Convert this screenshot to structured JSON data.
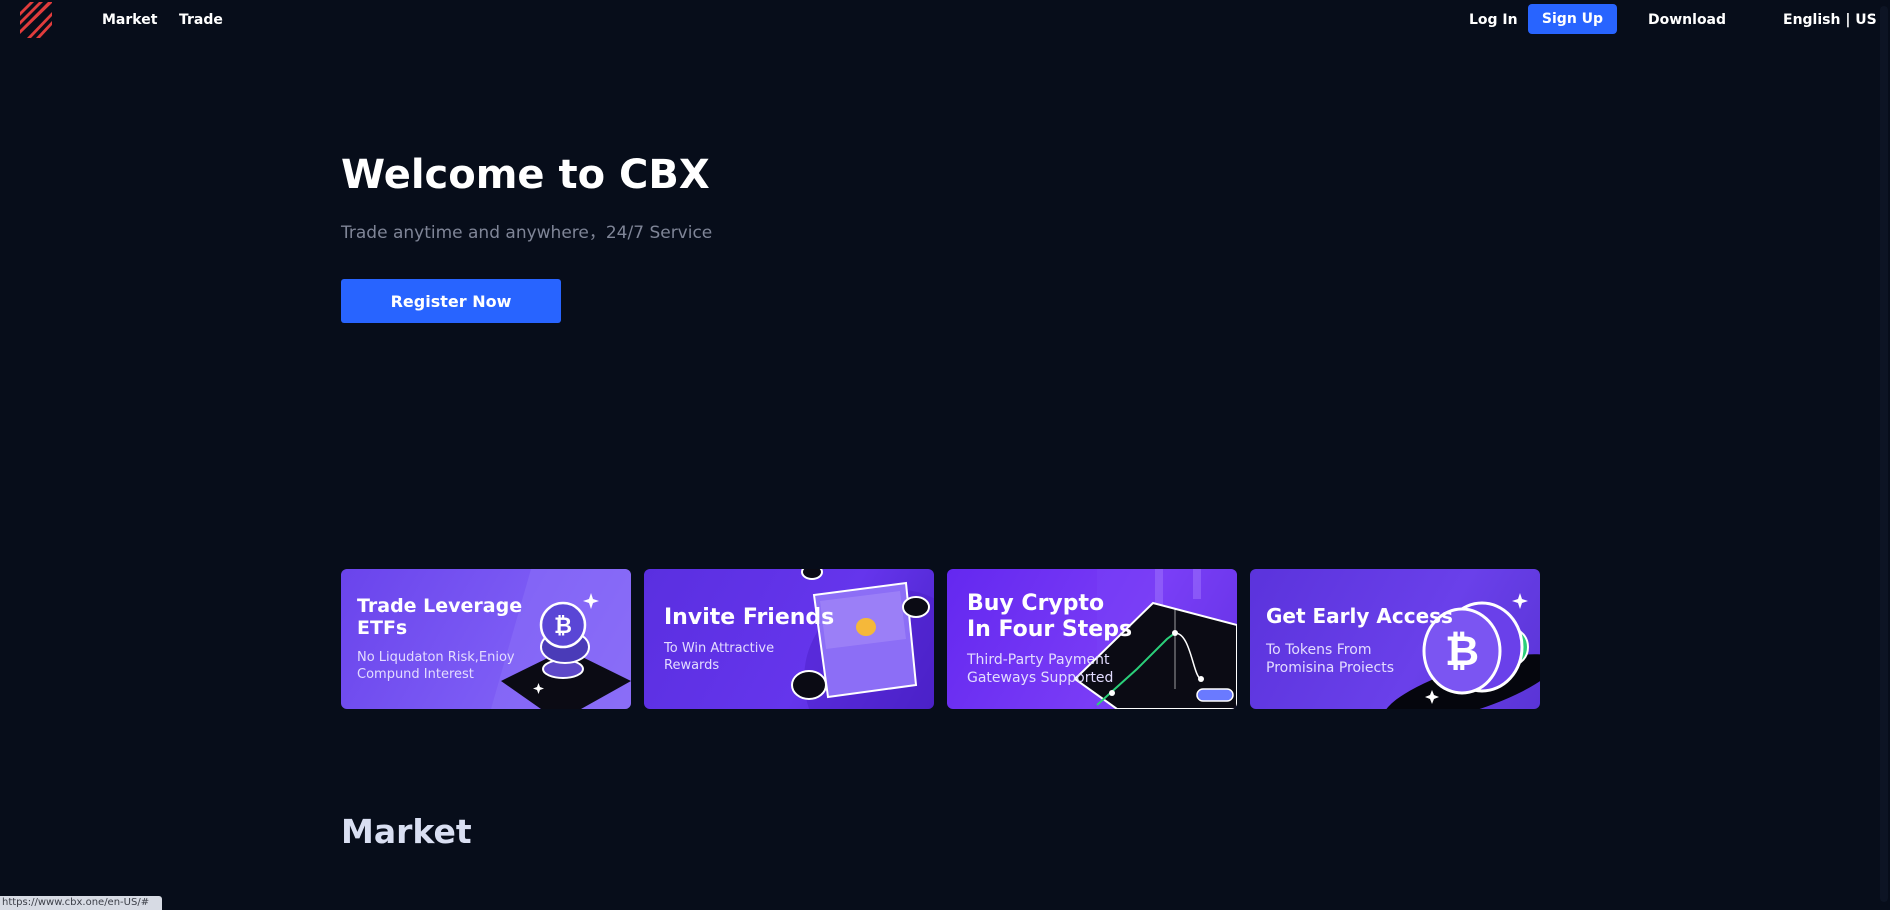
{
  "header": {
    "nav": {
      "market": "Market",
      "trade": "Trade"
    },
    "login": "Log In",
    "signup": "Sign Up",
    "download": "Download",
    "language_currency": "English | USD",
    "icons": {
      "logo": "stripes-logo-icon"
    }
  },
  "hero": {
    "title": "Welcome to CBX",
    "subtitle": "Trade anytime and anywhere，24/7 Service",
    "cta": "Register Now"
  },
  "banners": [
    {
      "title": "Trade Leverage\nETFs",
      "description": "No Liqudaton Risk,Enioy\nCompund Interest"
    },
    {
      "title": "Invite Friends",
      "description": "To Win Attractive\nRewards"
    },
    {
      "title": "Buy Crypto\nIn Four Steps",
      "description": "Third-Party Payment\nGateways Supported"
    },
    {
      "title": "Get Early Access",
      "description": "To Tokens From\nPromisina Proiects"
    }
  ],
  "market": {
    "heading": "Market"
  },
  "status_bar": {
    "url": "https://www.cbx.one/en-US/#"
  },
  "colors": {
    "background": "#070d1a",
    "accent": "#2864ff",
    "logo": "#e13c3c",
    "subtitle": "#7f8597",
    "card_purple": "#6a44ec"
  }
}
